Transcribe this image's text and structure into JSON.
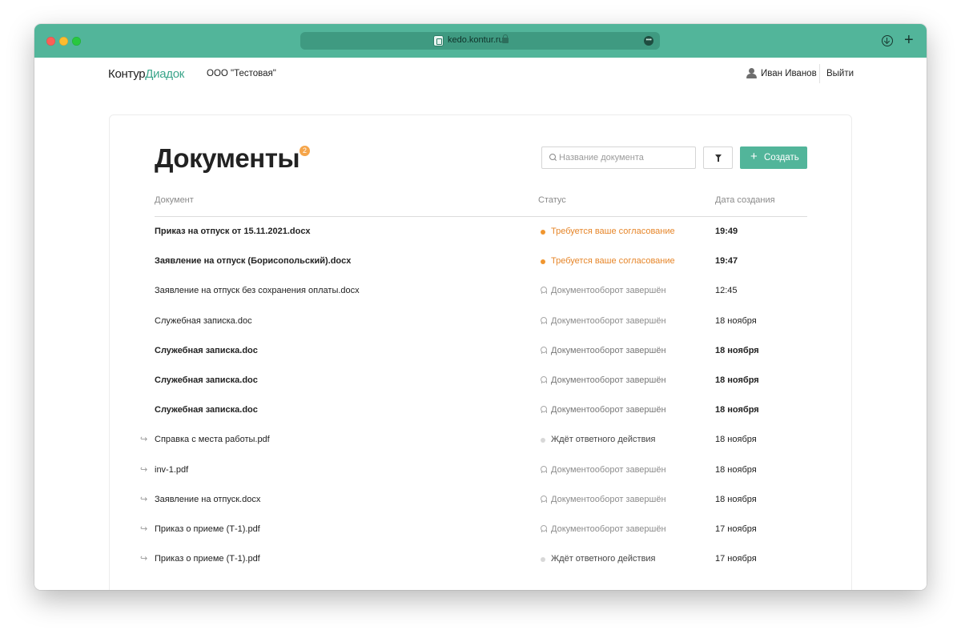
{
  "browser": {
    "url": "kedo.kontur.ru",
    "more_label": "•••",
    "new_tab_label": "+"
  },
  "header": {
    "brand_part1": "Контур",
    "brand_part2": "Диадок",
    "organization": "ООО \"Тестовая\"",
    "user_name": "Иван Иванов",
    "logout_label": "Выйти"
  },
  "main": {
    "title": "Документы",
    "badge_count": "2",
    "search_placeholder": "Название документа",
    "create_label": "Создать",
    "create_icon": "+",
    "columns": {
      "document": "Документ",
      "status": "Статус",
      "date": "Дата создания"
    },
    "rows": [
      {
        "name": "Приказ на отпуск от 15.11.2021.docx",
        "status": "Требуется ваше согласование",
        "date": "19:49"
      },
      {
        "name": "Заявление на отпуск (Борисопольский).docx",
        "status": "Требуется ваше согласование",
        "date": "19:47"
      },
      {
        "name": "Заявление на отпуск без сохранения оплаты.docx",
        "status": "Документооборот завершён",
        "date": "12:45"
      },
      {
        "name": "Служебная записка.doc",
        "status": "Документооборот завершён",
        "date": "18 ноября"
      },
      {
        "name": "Служебная записка.doc",
        "status": "Документооборот завершён",
        "date": "18 ноября"
      },
      {
        "name": "Служебная записка.doc",
        "status": "Документооборот завершён",
        "date": "18 ноября"
      },
      {
        "name": "Служебная записка.doc",
        "status": "Документооборот завершён",
        "date": "18 ноября"
      },
      {
        "name": "Справка с места работы.pdf",
        "status": "Ждёт ответного действия",
        "date": "18 ноября",
        "forward_icon": "↪"
      },
      {
        "name": "inv-1.pdf",
        "status": "Документооборот завершён",
        "date": "18 ноября",
        "forward_icon": "↪"
      },
      {
        "name": "Заявление на отпуск.docx",
        "status": "Документооборот завершён",
        "date": "18 ноября",
        "forward_icon": "↪"
      },
      {
        "name": "Приказ о приеме (Т-1).pdf",
        "status": "Документооборот завершён",
        "date": "17 ноября",
        "forward_icon": "↪"
      },
      {
        "name": "Приказ о приеме (Т-1).pdf",
        "status": "Ждёт ответного действия",
        "date": "17 ноября",
        "forward_icon": "↪"
      }
    ]
  },
  "colors": {
    "accent": "#52b59a",
    "brand_green": "#3aa58a",
    "pending_orange": "#e6862a",
    "badge_orange": "#f5a54a"
  },
  "icons": [
    "download-icon",
    "user-icon",
    "search-icon",
    "filter-icon",
    "plus-icon",
    "forward-icon",
    "certificate-icon",
    "status-dot-icon"
  ]
}
